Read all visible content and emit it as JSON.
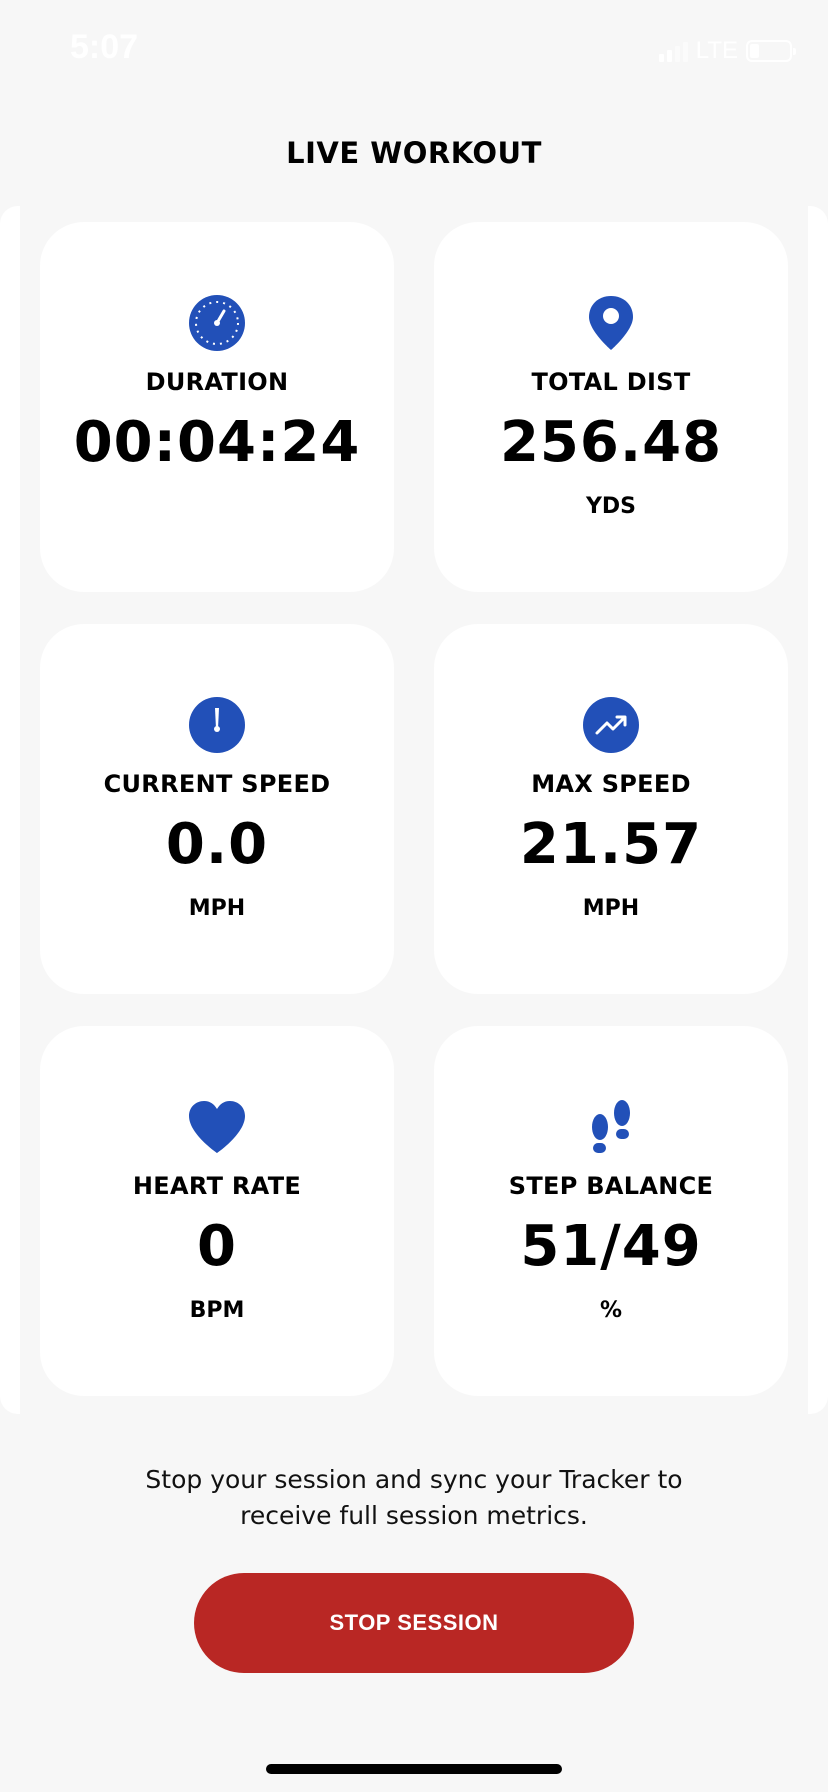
{
  "status_bar": {
    "time": "5:07",
    "network": "LTE"
  },
  "page": {
    "title": "LIVE WORKOUT"
  },
  "cards": {
    "duration": {
      "label": "DURATION",
      "value": "00:04:24",
      "unit": "",
      "icon": "stopwatch-icon"
    },
    "total_distance": {
      "label": "TOTAL DIST",
      "value": "256.48",
      "unit": "YDS",
      "icon": "location-pin-icon"
    },
    "current_speed": {
      "label": "CURRENT SPEED",
      "value": "0.0",
      "unit": "MPH",
      "icon": "gauge-icon"
    },
    "max_speed": {
      "label": "MAX SPEED",
      "value": "21.57",
      "unit": "MPH",
      "icon": "trend-up-icon"
    },
    "heart_rate": {
      "label": "HEART RATE",
      "value": "0",
      "unit": "BPM",
      "icon": "heart-icon"
    },
    "step_balance": {
      "label": "STEP BALANCE",
      "value": "51/49",
      "unit": "%",
      "icon": "footsteps-icon"
    }
  },
  "footer": {
    "message": "Stop your session and sync your Tracker to receive full session metrics.",
    "stop_button_label": "STOP SESSION"
  },
  "colors": {
    "accent_blue": "#2250b8",
    "stop_red": "#b92724",
    "background": "#f7f7f7",
    "card": "#ffffff"
  }
}
